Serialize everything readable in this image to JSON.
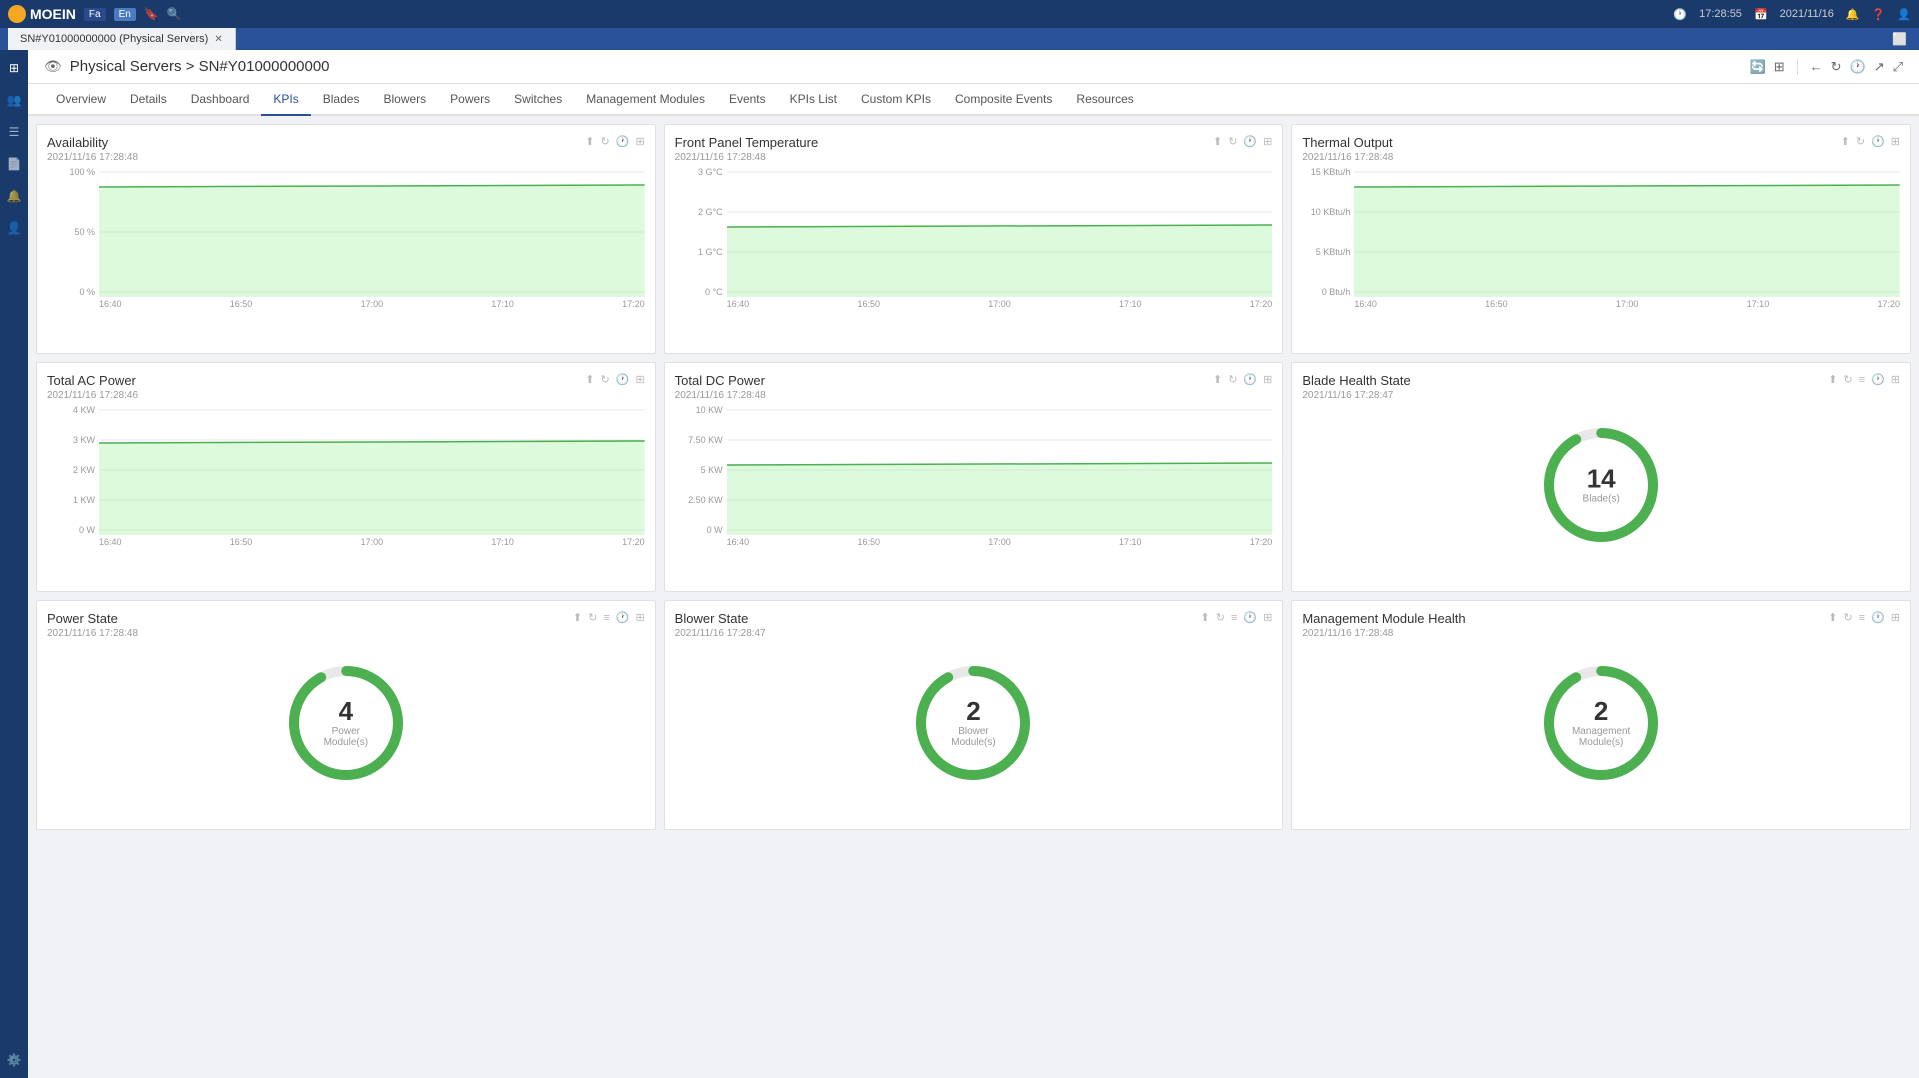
{
  "topBar": {
    "logo": "MOEIN",
    "lang1": "Fa",
    "lang2": "En",
    "time": "17:28:55",
    "date": "2021/11/16"
  },
  "tab": {
    "label": "SN#Y01000000000 (Physical Servers)",
    "expandLabel": "⬜"
  },
  "pageHeader": {
    "breadcrumb": "Physical Servers > SN#Y01000000000"
  },
  "navTabs": {
    "items": [
      {
        "label": "Overview"
      },
      {
        "label": "Details"
      },
      {
        "label": "Dashboard"
      },
      {
        "label": "KPIs",
        "active": true
      },
      {
        "label": "Blades"
      },
      {
        "label": "Blowers"
      },
      {
        "label": "Powers"
      },
      {
        "label": "Switches"
      },
      {
        "label": "Management Modules"
      },
      {
        "label": "Events"
      },
      {
        "label": "KPIs List"
      },
      {
        "label": "Custom KPIs"
      },
      {
        "label": "Composite Events"
      },
      {
        "label": "Resources"
      }
    ]
  },
  "kpis": [
    {
      "id": "availability",
      "title": "Availability",
      "date": "2021/11/16   17:28:48",
      "type": "line",
      "yLabels": [
        "100 %",
        "50 %",
        "0 %"
      ],
      "xLabels": [
        "16:40",
        "16:50",
        "17:00",
        "17:10",
        "17:20"
      ],
      "chartData": "area-high"
    },
    {
      "id": "front-panel-temp",
      "title": "Front Panel Temperature",
      "date": "2021/11/16   17:28:48",
      "type": "line",
      "yLabels": [
        "3 G°C",
        "2 G°C",
        "1 G°C",
        "0 °C"
      ],
      "xLabels": [
        "16:40",
        "16:50",
        "17:00",
        "17:10",
        "17:20"
      ],
      "chartData": "area-mid"
    },
    {
      "id": "thermal-output",
      "title": "Thermal Output",
      "date": "2021/11/16   17:28:48",
      "type": "line",
      "yLabels": [
        "15 KBtu/h",
        "10 KBtu/h",
        "5 KBtu/h",
        "0 Btu/h"
      ],
      "xLabels": [
        "16:40",
        "16:50",
        "17:00",
        "17:10",
        "17:20"
      ],
      "chartData": "area-high"
    },
    {
      "id": "total-ac-power",
      "title": "Total AC Power",
      "date": "2021/11/16   17:28:46",
      "type": "line",
      "yLabels": [
        "4 KW",
        "3 KW",
        "2 KW",
        "1 KW",
        "0 W"
      ],
      "xLabels": [
        "16:40",
        "16:50",
        "17:00",
        "17:10",
        "17:20"
      ],
      "chartData": "area-mid-high"
    },
    {
      "id": "total-dc-power",
      "title": "Total DC Power",
      "date": "2021/11/16   17:28:48",
      "type": "line",
      "yLabels": [
        "10 KW",
        "7.50 KW",
        "5 KW",
        "2.50 KW",
        "0 W"
      ],
      "xLabels": [
        "16:40",
        "16:50",
        "17:00",
        "17:10",
        "17:20"
      ],
      "chartData": "area-mid"
    },
    {
      "id": "blade-health-state",
      "title": "Blade Health State",
      "date": "2021/11/16   17:28:47",
      "type": "donut",
      "donutValue": "14",
      "donutLabel": "Blade(s)",
      "hasListIcon": true
    },
    {
      "id": "power-state",
      "title": "Power State",
      "date": "2021/11/16   17:28:48",
      "type": "donut",
      "donutValue": "4",
      "donutLabel": "Power Module(s)",
      "hasListIcon": true
    },
    {
      "id": "blower-state",
      "title": "Blower State",
      "date": "2021/11/16   17:28:47",
      "type": "donut",
      "donutValue": "2",
      "donutLabel": "Blower Module(s)",
      "hasListIcon": true
    },
    {
      "id": "mgmt-module-health",
      "title": "Management Module Health",
      "date": "2021/11/16   17:28:48",
      "type": "donut",
      "donutValue": "2",
      "donutLabel": "Management Module(s)",
      "hasListIcon": true
    }
  ],
  "sidebar": {
    "icons": [
      "👤",
      "👥",
      "📋",
      "📄",
      "🔔",
      "👤",
      "⚙️"
    ]
  }
}
